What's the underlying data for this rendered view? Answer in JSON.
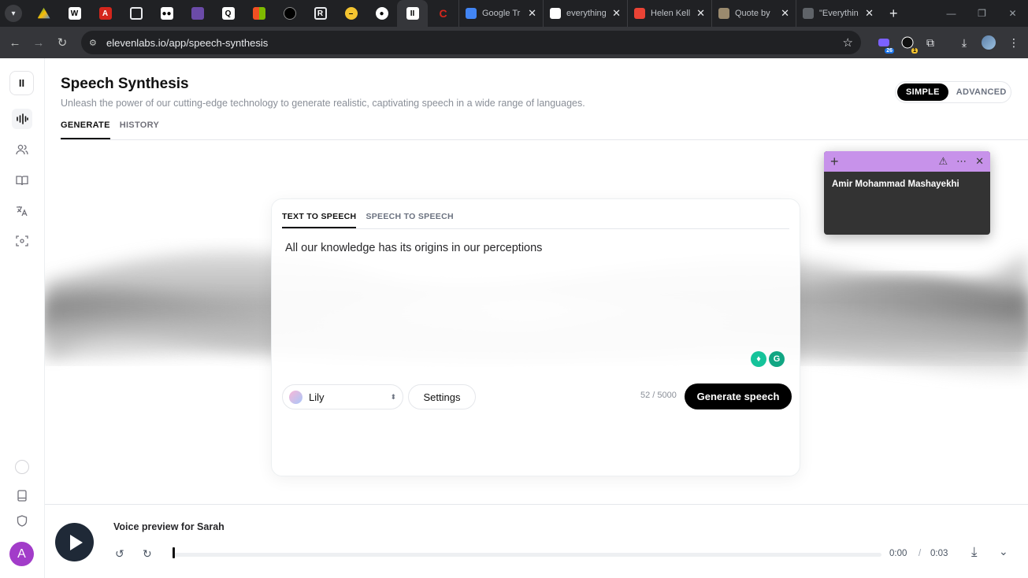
{
  "browser": {
    "tabs": [
      {
        "title": "Google Tr",
        "fav_color": "#4285f4"
      },
      {
        "title": "everything",
        "fav_color": "#ffffff"
      },
      {
        "title": "Helen Kell",
        "fav_color": "#ea4335"
      },
      {
        "title": "Quote by",
        "fav_color": "#9a8a6e"
      },
      {
        "title": "\"Everythin",
        "fav_color": "#5f6368"
      }
    ],
    "url": "elevenlabs.io/app/speech-synthesis",
    "ext_badge_1": "26",
    "ext_badge_2": "1"
  },
  "page": {
    "title": "Speech Synthesis",
    "subtitle": "Unleash the power of our cutting-edge technology to generate realistic, captivating speech in a wide range of languages.",
    "tabs": [
      {
        "label": "GENERATE"
      },
      {
        "label": "HISTORY"
      }
    ],
    "mode": {
      "simple": "SIMPLE",
      "advanced": "ADVANCED"
    }
  },
  "sidebar": {
    "logo": "II",
    "avatar_letter": "A"
  },
  "editor": {
    "tabs": [
      {
        "label": "TEXT TO SPEECH"
      },
      {
        "label": "SPEECH TO SPEECH"
      }
    ],
    "text": "All our knowledge has its origins in our perceptions",
    "voice": "Lily",
    "settings_label": "Settings",
    "char_count": "52 / 5000",
    "generate_label": "Generate speech"
  },
  "sticky_note": {
    "text": "Amir Mohammad Mashayekhi"
  },
  "player": {
    "title": "Voice preview for Sarah",
    "current_time": "0:00",
    "separator": "/",
    "duration": "0:03"
  }
}
